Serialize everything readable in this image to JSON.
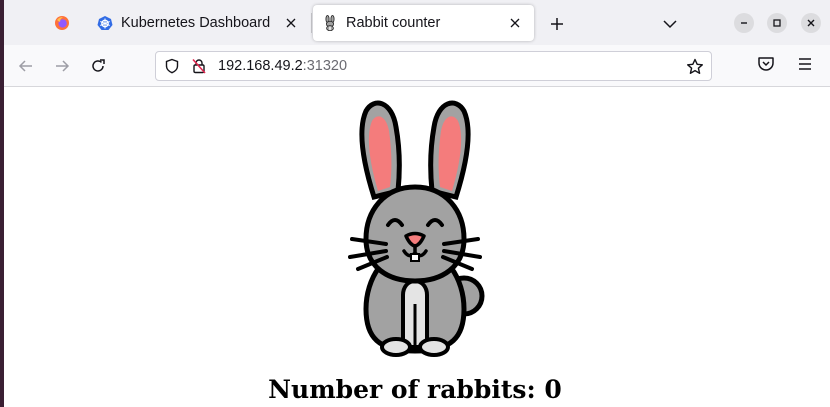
{
  "tabs": [
    {
      "title": "Kubernetes Dashboard",
      "favicon": "kubernetes-icon",
      "active": false
    },
    {
      "title": "Rabbit counter",
      "favicon": "rabbit-icon",
      "active": true
    }
  ],
  "urlbar": {
    "host": "192.168.49.2",
    "port": ":31320"
  },
  "page": {
    "heading": "Number of rabbits: 0"
  },
  "colors": {
    "rabbit_body": "#a2a2a2",
    "rabbit_ear_inner": "#f47c7c",
    "rabbit_belly": "#e4e4e4",
    "outline": "#000000",
    "kubernetes_blue": "#326ce5"
  }
}
